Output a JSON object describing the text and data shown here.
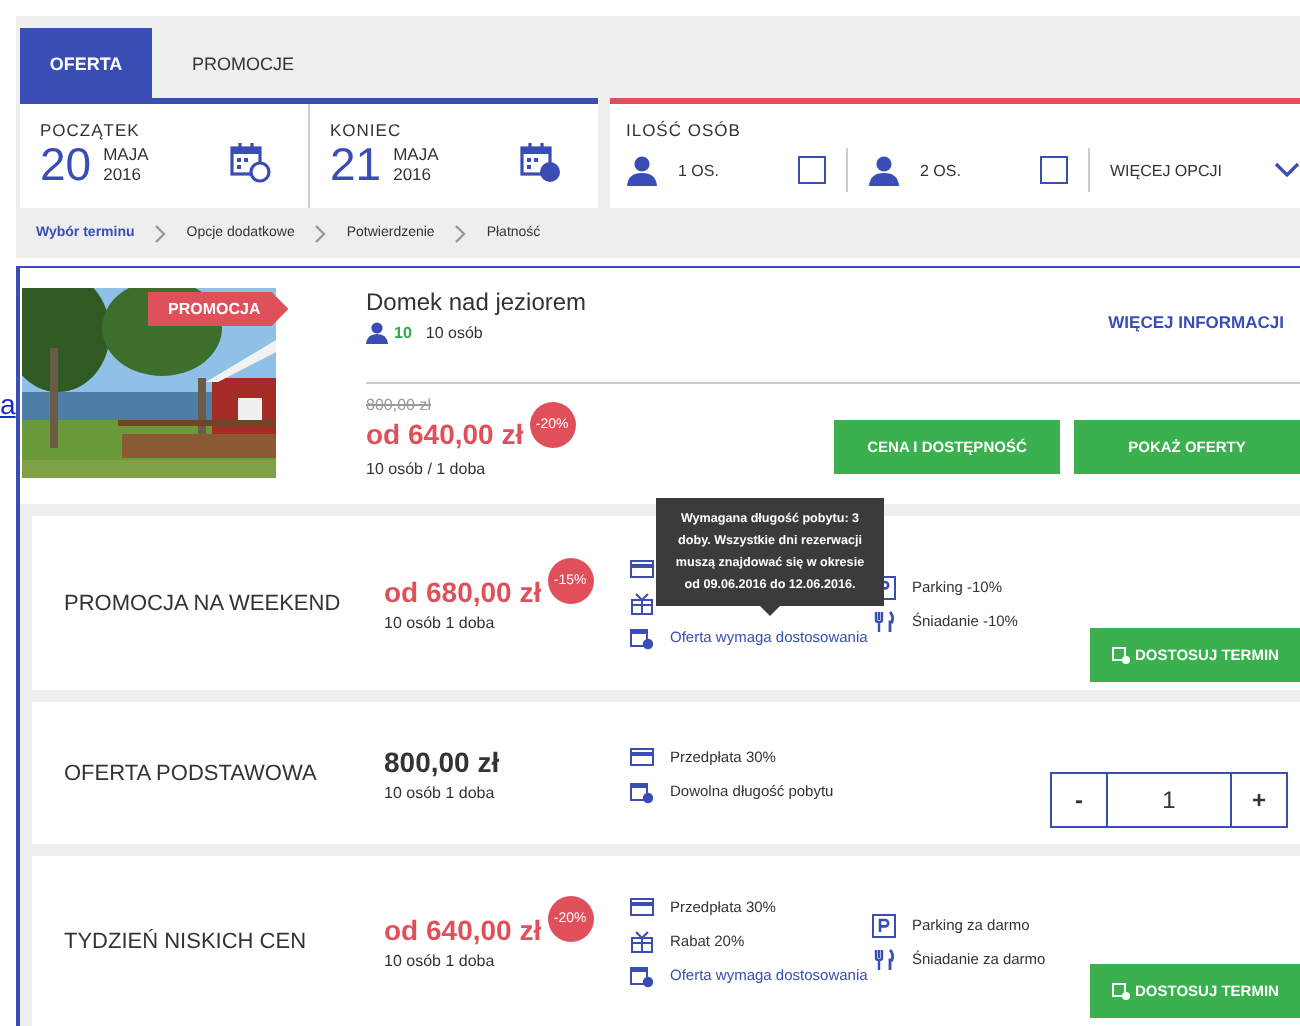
{
  "side_link": "a",
  "tabs": [
    {
      "label": "OFERTA",
      "selected": true
    },
    {
      "label": "PROMOCJE",
      "selected": false
    }
  ],
  "dates": [
    {
      "label": "POCZĄTEK",
      "day": "20",
      "month": "MAJA",
      "year": "2016"
    },
    {
      "label": "KONIEC",
      "day": "21",
      "month": "MAJA",
      "year": "2016"
    }
  ],
  "guests": {
    "label": "ILOŚĆ OSÓB",
    "options": [
      {
        "label": "1 OS.",
        "checked": false
      },
      {
        "label": "2 OS.",
        "checked": false
      }
    ],
    "more": "WIĘCEJ OPCJI"
  },
  "breadcrumb": [
    {
      "label": "Wybór terminu",
      "selected": true
    },
    {
      "label": "Opcje dodatkowe",
      "selected": false
    },
    {
      "label": "Potwierdzenie",
      "selected": false
    },
    {
      "label": "Płatność",
      "selected": false
    }
  ],
  "hotel": {
    "badge": "PROMOCJA",
    "name": "Domek nad jeziorem",
    "capacity": "10",
    "capacity_label": "10 osób",
    "more": "WIĘCEJ INFORMACJI",
    "old_price": "800,00 zł",
    "price": "od 640,00 zł",
    "discount": "-20%",
    "per": "10 osób / 1 doba",
    "buttons": [
      "CENA I DOSTĘPNOŚĆ",
      "POKAŻ OFERTY"
    ]
  },
  "offers": [
    {
      "name": "PROMOCJA NA WEEKEND",
      "price": "od 680,00 zł",
      "kind": "promo",
      "discount": "-15%",
      "per": "10 osób 1 doba",
      "features": [
        {
          "kind": "card"
        },
        {
          "kind": "gift"
        },
        {
          "kind": "calendar",
          "text": "Oferta wymaga dostosowania",
          "link": true
        }
      ],
      "features2": [
        {
          "kind": "parking",
          "text": "Parking -10%",
          "link": false
        },
        {
          "kind": "cutlery",
          "text": "Śniadanie -10%",
          "link": false
        }
      ],
      "action": {
        "kind": "button",
        "label": "DOSTOSUJ TERMIN"
      }
    },
    {
      "name": "OFERTA PODSTAWOWA",
      "price": "800,00 zł",
      "kind": "regular",
      "per": "10 osób 1 doba",
      "features": [
        {
          "kind": "card",
          "text": "Przedpłata 30%",
          "link": false
        },
        {
          "kind": "calendar",
          "text": "Dowolna długość pobytu",
          "link": false
        }
      ],
      "action": {
        "kind": "stepper",
        "minus": "-",
        "value": "1",
        "plus": "+"
      }
    },
    {
      "name": "TYDZIEŃ NISKICH CEN",
      "price": "od 640,00 zł",
      "kind": "promo",
      "discount": "-20%",
      "per": "10 osób 1 doba",
      "features": [
        {
          "kind": "card",
          "text": "Przedpłata 30%",
          "link": false
        },
        {
          "kind": "gift",
          "text": "Rabat 20%",
          "link": false
        },
        {
          "kind": "calendar",
          "text": "Oferta wymaga dostosowania",
          "link": true
        }
      ],
      "features2": [
        {
          "kind": "parking",
          "text": "Parking za darmo",
          "link": false
        },
        {
          "kind": "cutlery",
          "text": "Śniadanie za darmo",
          "link": false
        }
      ],
      "action": {
        "kind": "button",
        "label": "DOSTOSUJ TERMIN"
      }
    }
  ],
  "tooltip": "Wymagana długość pobytu: 3 doby. Wszystkie dni rezerwacji muszą znajdować się w okresie od 09.06.2016 do 12.06.2016."
}
